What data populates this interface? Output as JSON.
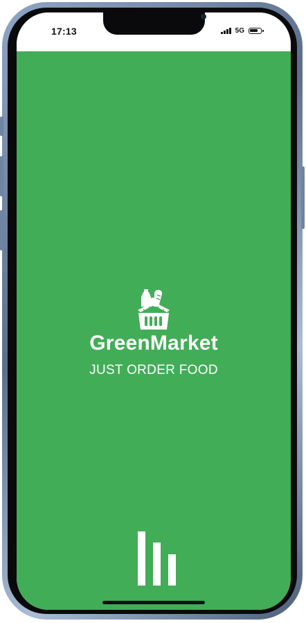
{
  "status_bar": {
    "time": "17:13",
    "network": "5G",
    "battery_level": 0.85,
    "signal_bars": 4
  },
  "splash": {
    "app_name": "GreenMarket",
    "tagline": "JUST ORDER FOOD",
    "logo_icon": "grocery-basket-icon",
    "loading_icon": "loading-bars-icon"
  },
  "colors": {
    "background": "#42ad57",
    "foreground": "#ffffff"
  }
}
